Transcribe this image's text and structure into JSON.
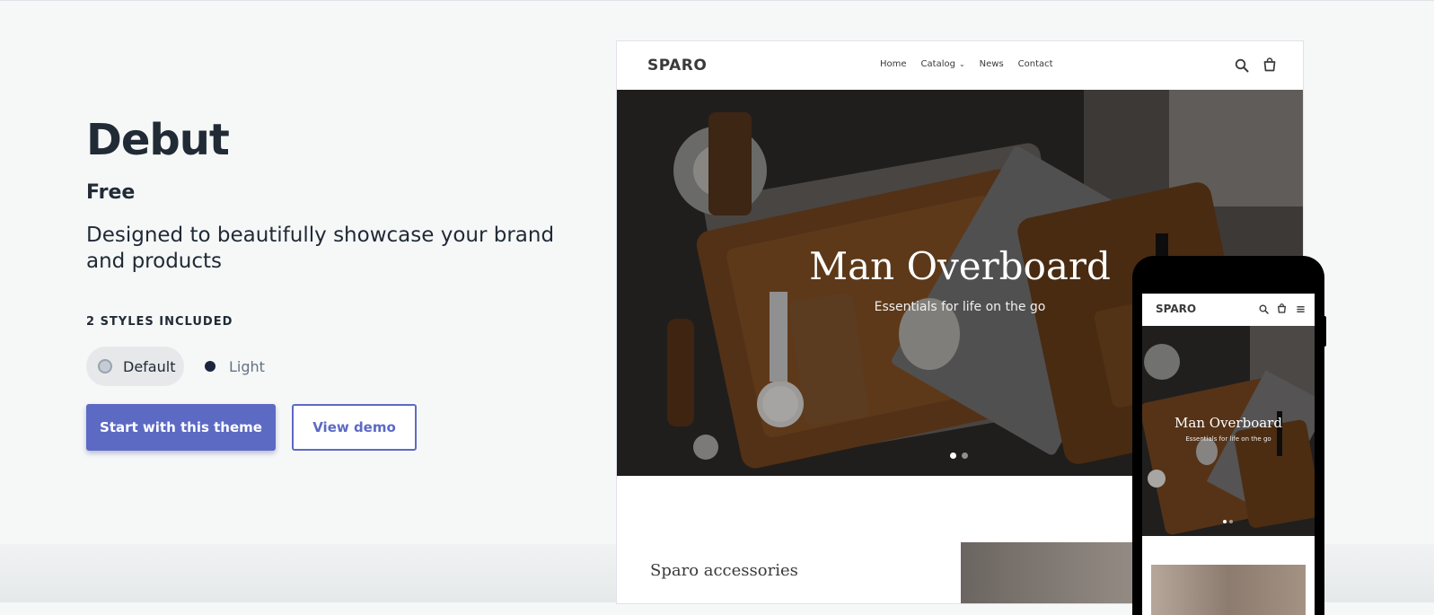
{
  "theme": {
    "name": "Debut",
    "price": "Free",
    "description": "Designed to beautifully showcase your brand and products",
    "styles_heading": "2 STYLES INCLUDED",
    "styles": [
      {
        "label": "Default",
        "color": "#c4cdd5",
        "selected": true
      },
      {
        "label": "Light",
        "color": "#1c2540",
        "selected": false
      }
    ],
    "primary_button": "Start with this theme",
    "secondary_button": "View demo"
  },
  "colors": {
    "accent": "#5c6ac4",
    "text": "#212b36",
    "background": "#f6f8f8"
  },
  "desktop_preview": {
    "store_name": "SPARO",
    "nav": [
      {
        "label": "Home"
      },
      {
        "label": "Catalog",
        "icon": "chevron-down-icon"
      },
      {
        "label": "News"
      },
      {
        "label": "Contact"
      }
    ],
    "icons": [
      "search-icon",
      "cart-icon"
    ],
    "hero_title": "Man Overboard",
    "hero_subtitle": "Essentials for life on the go",
    "slide_count": 2,
    "active_slide": 1,
    "section_title": "Sparo accessories"
  },
  "mobile_preview": {
    "store_name": "SPARO",
    "icons": [
      "search-icon",
      "cart-icon",
      "menu-icon"
    ],
    "hero_title": "Man Overboard",
    "hero_subtitle": "Essentials for life on the go",
    "slide_count": 2,
    "active_slide": 1
  }
}
